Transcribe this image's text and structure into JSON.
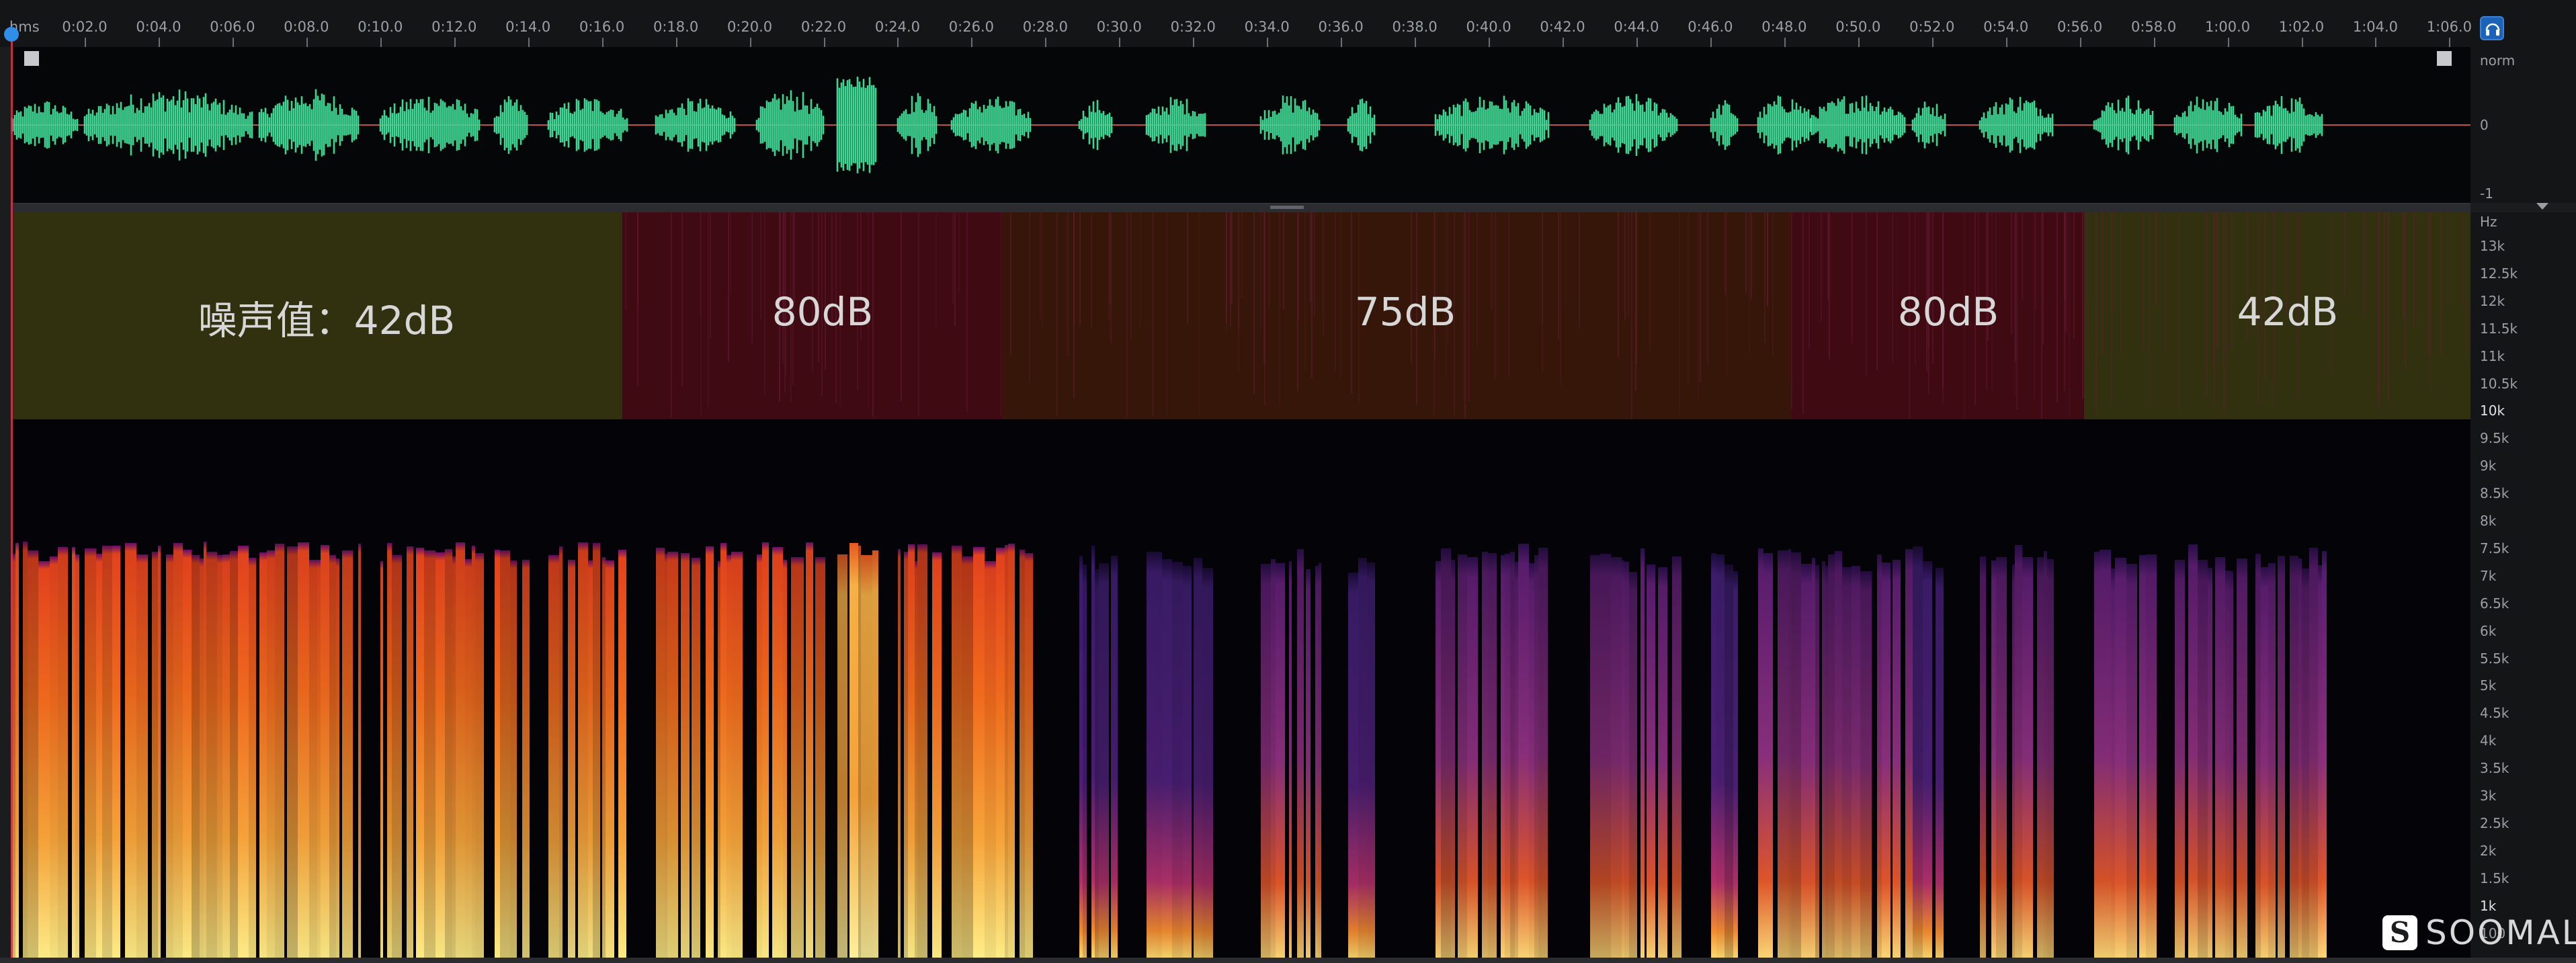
{
  "ruler": {
    "unit_label": "hms",
    "ticks": [
      "0:02.0",
      "0:04.0",
      "0:06.0",
      "0:08.0",
      "0:10.0",
      "0:12.0",
      "0:14.0",
      "0:16.0",
      "0:18.0",
      "0:20.0",
      "0:22.0",
      "0:24.0",
      "0:26.0",
      "0:28.0",
      "0:30.0",
      "0:32.0",
      "0:34.0",
      "0:36.0",
      "0:38.0",
      "0:40.0",
      "0:42.0",
      "0:44.0",
      "0:46.0",
      "0:48.0",
      "0:50.0",
      "0:52.0",
      "0:54.0",
      "0:56.0",
      "0:58.0",
      "1:00.0",
      "1:02.0",
      "1:04.0",
      "1:06.0"
    ]
  },
  "waveform": {
    "scale_labels": [
      "norm",
      "0",
      "-1"
    ],
    "color": "#3fd694",
    "center_line_color": "#c0504d"
  },
  "spectrogram": {
    "unit": "Hz",
    "scale_labels": [
      "13k",
      "12.5k",
      "12k",
      "11.5k",
      "11k",
      "10.5k",
      "10k",
      "9.5k",
      "9k",
      "8.5k",
      "8k",
      "7.5k",
      "7k",
      "6.5k",
      "6k",
      "5.5k",
      "5k",
      "4.5k",
      "4k",
      "3.5k",
      "3k",
      "2.5k",
      "2k",
      "1.5k",
      "1k",
      "100"
    ],
    "noise_segments": [
      {
        "label": "噪声值：42dB",
        "color": "#3a3a12"
      },
      {
        "label": "80dB",
        "color": "#4a0c14"
      },
      {
        "label": "75dB",
        "color": "#3e1a08"
      },
      {
        "label": "80dB",
        "color": "#4a0c14"
      },
      {
        "label": "42dB",
        "color": "#3a3a12"
      }
    ]
  },
  "watermark": {
    "logo_glyph": "S",
    "text": "SOOMAL"
  },
  "icons": [
    "headphone-icon",
    "zoom-corner-icon",
    "collapse-arrow-icon",
    "playhead-marker-icon"
  ]
}
